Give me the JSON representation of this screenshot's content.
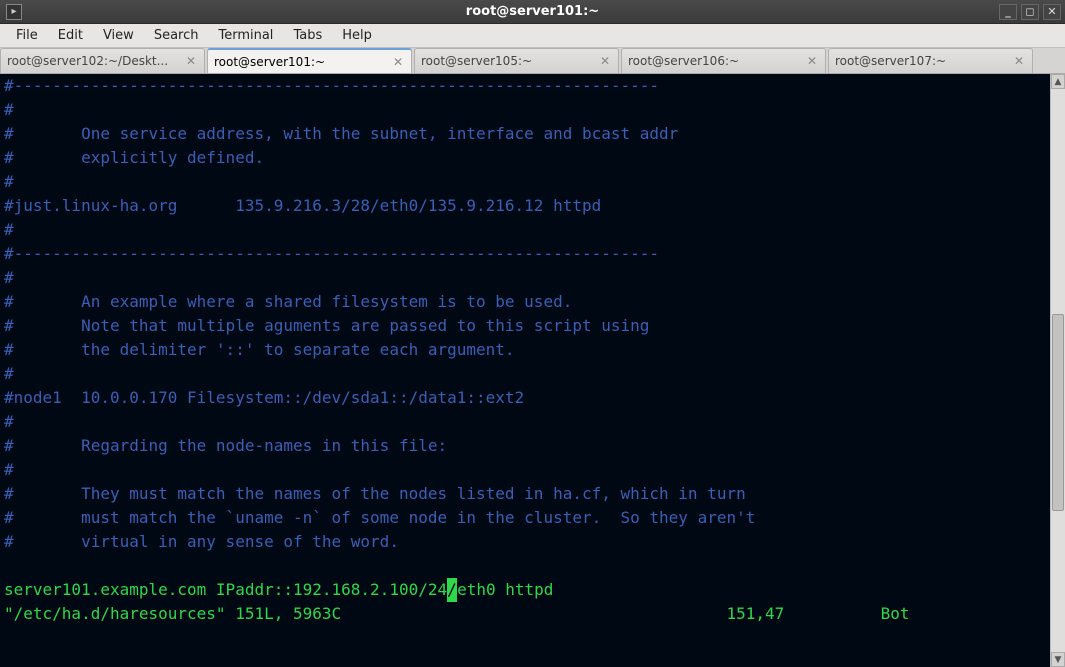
{
  "window": {
    "title": "root@server101:~"
  },
  "menu": {
    "file": "File",
    "edit": "Edit",
    "view": "View",
    "search": "Search",
    "terminal": "Terminal",
    "tabs": "Tabs",
    "help": "Help"
  },
  "tabs": [
    {
      "label": "root@server102:~/Deskt...",
      "active": false
    },
    {
      "label": "root@server101:~",
      "active": true
    },
    {
      "label": "root@server105:~",
      "active": false
    },
    {
      "label": "root@server106:~",
      "active": false
    },
    {
      "label": "root@server107:~",
      "active": false
    }
  ],
  "terminal": {
    "lines": [
      "#-------------------------------------------------------------------",
      "#",
      "#       One service address, with the subnet, interface and bcast addr",
      "#       explicitly defined.",
      "#",
      "#just.linux-ha.org      135.9.216.3/28/eth0/135.9.216.12 httpd",
      "#",
      "#-------------------------------------------------------------------",
      "#",
      "#       An example where a shared filesystem is to be used.",
      "#       Note that multiple aguments are passed to this script using",
      "#       the delimiter '::' to separate each argument.",
      "#",
      "#node1  10.0.0.170 Filesystem::/dev/sda1::/data1::ext2",
      "#",
      "#       Regarding the node-names in this file:",
      "#",
      "#       They must match the names of the nodes listed in ha.cf, which in turn",
      "#       must match the `uname -n` of some node in the cluster.  So they aren't",
      "#       virtual in any sense of the word.",
      ""
    ],
    "config_pre": "server101.example.com IPaddr::192.168.2.100/24",
    "config_cursor": "/",
    "config_post": "eth0 httpd",
    "status_file": "\"/etc/ha.d/haresources\" 151L, 5963C",
    "status_pos": "151,47",
    "status_loc": "Bot"
  }
}
